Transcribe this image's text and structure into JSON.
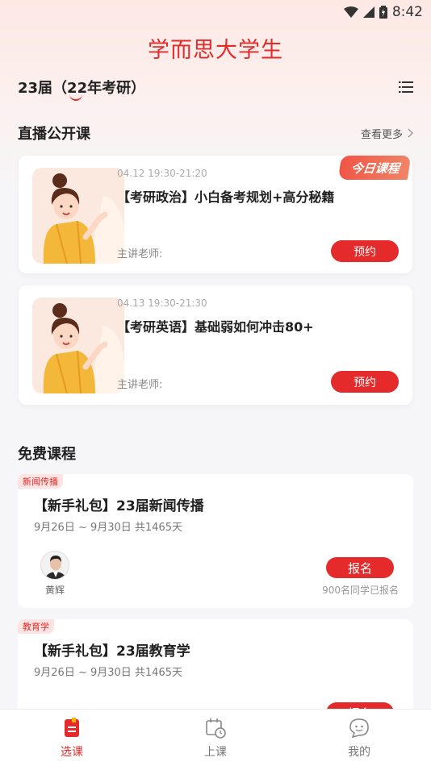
{
  "status": {
    "time": "8:42"
  },
  "app_title": "学而思大学生",
  "grade": {
    "label": "23届（22年考研）"
  },
  "live_section": {
    "title": "直播公开课",
    "see_more": "查看更多"
  },
  "live_courses": [
    {
      "time": "04.12 19:30-21:20",
      "title": "【考研政治】小白备考规划+高分秘籍",
      "teacher_label": "主讲老师:",
      "button": "预约",
      "badge": "今日课程"
    },
    {
      "time": "04.13 19:30-21:30",
      "title": "【考研英语】基础弱如何冲击80+",
      "teacher_label": "主讲老师:",
      "button": "预约"
    }
  ],
  "free_section": {
    "title": "免费课程"
  },
  "free_courses": [
    {
      "tag": "新闻传播",
      "title": "【新手礼包】23届新闻传播",
      "date": "9月26日 ~ 9月30日 共1465天",
      "teacher": "黄辉",
      "button": "报名",
      "count": "900名同学已报名"
    },
    {
      "tag": "教育学",
      "title": "【新手礼包】23届教育学",
      "date": "9月26日 ~ 9月30日 共1465天",
      "button": "报名"
    }
  ],
  "bottom_nav": [
    {
      "label": "选课",
      "icon": "course-select-icon",
      "active": true
    },
    {
      "label": "上课",
      "icon": "calendar-clock-icon",
      "active": false
    },
    {
      "label": "我的",
      "icon": "chat-face-icon",
      "active": false
    }
  ],
  "colors": {
    "accent": "#e42a2a",
    "tag_bg": "#fde4e2"
  }
}
